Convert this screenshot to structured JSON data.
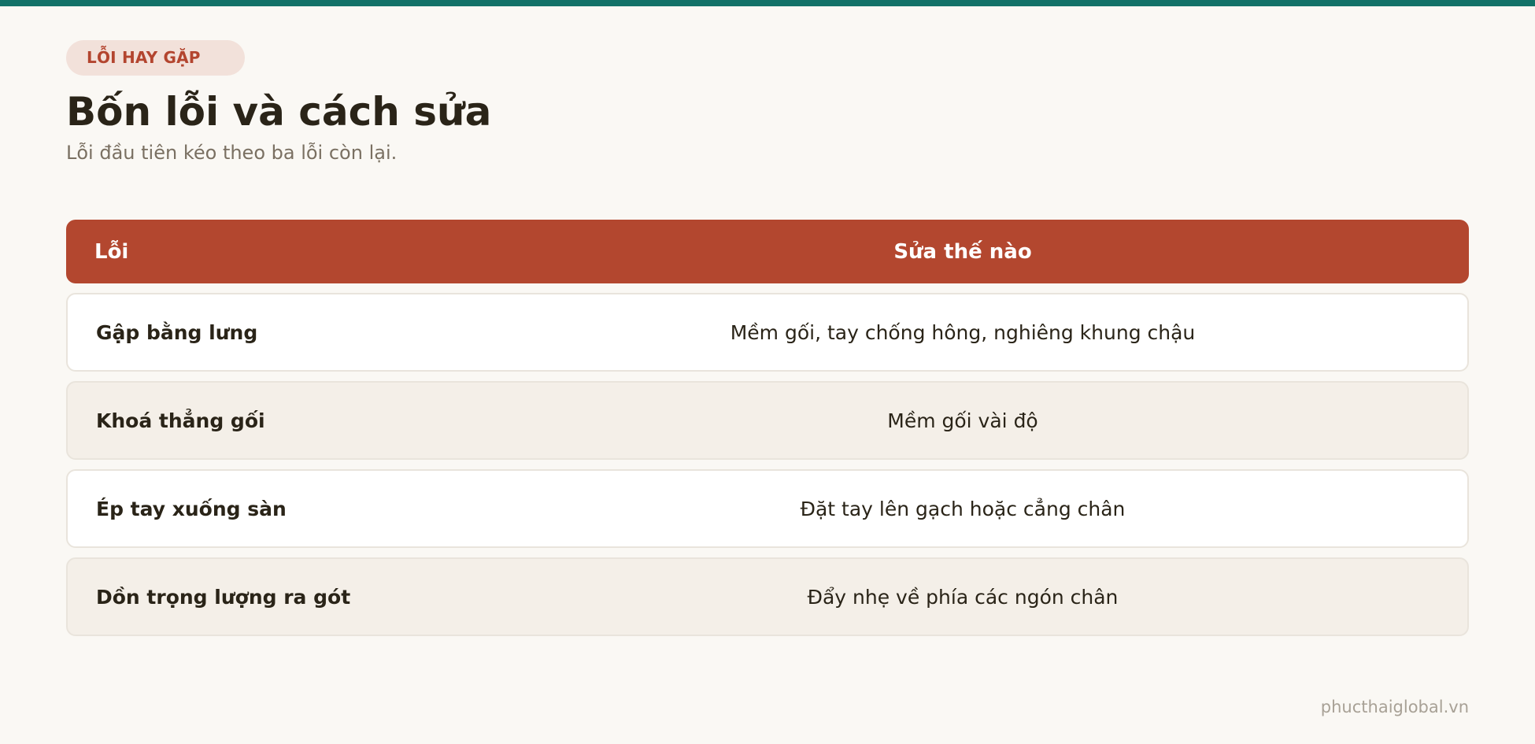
{
  "badge": "LỖI HAY GẶP",
  "title": "Bốn lỗi và cách sửa",
  "subtitle": "Lỗi đầu tiên kéo theo ba lỗi còn lại.",
  "table": {
    "headers": {
      "error": "Lỗi",
      "fix": "Sửa thế nào"
    },
    "rows": [
      {
        "error": "Gập bằng lưng",
        "fix": "Mềm gối, tay chống hông, nghiêng khung chậu"
      },
      {
        "error": "Khoá thẳng gối",
        "fix": "Mềm gối vài độ"
      },
      {
        "error": "Ép tay xuống sàn",
        "fix": "Đặt tay lên gạch hoặc cẳng chân"
      },
      {
        "error": "Dồn trọng lượng ra gót",
        "fix": "Đẩy nhẹ về phía các ngón chân"
      }
    ]
  },
  "footer": "phucthaiglobal.vn",
  "colors": {
    "accent": "#137268",
    "header": "#b3472f",
    "badge_bg": "#f2e1da",
    "badge_text": "#b3452f"
  }
}
